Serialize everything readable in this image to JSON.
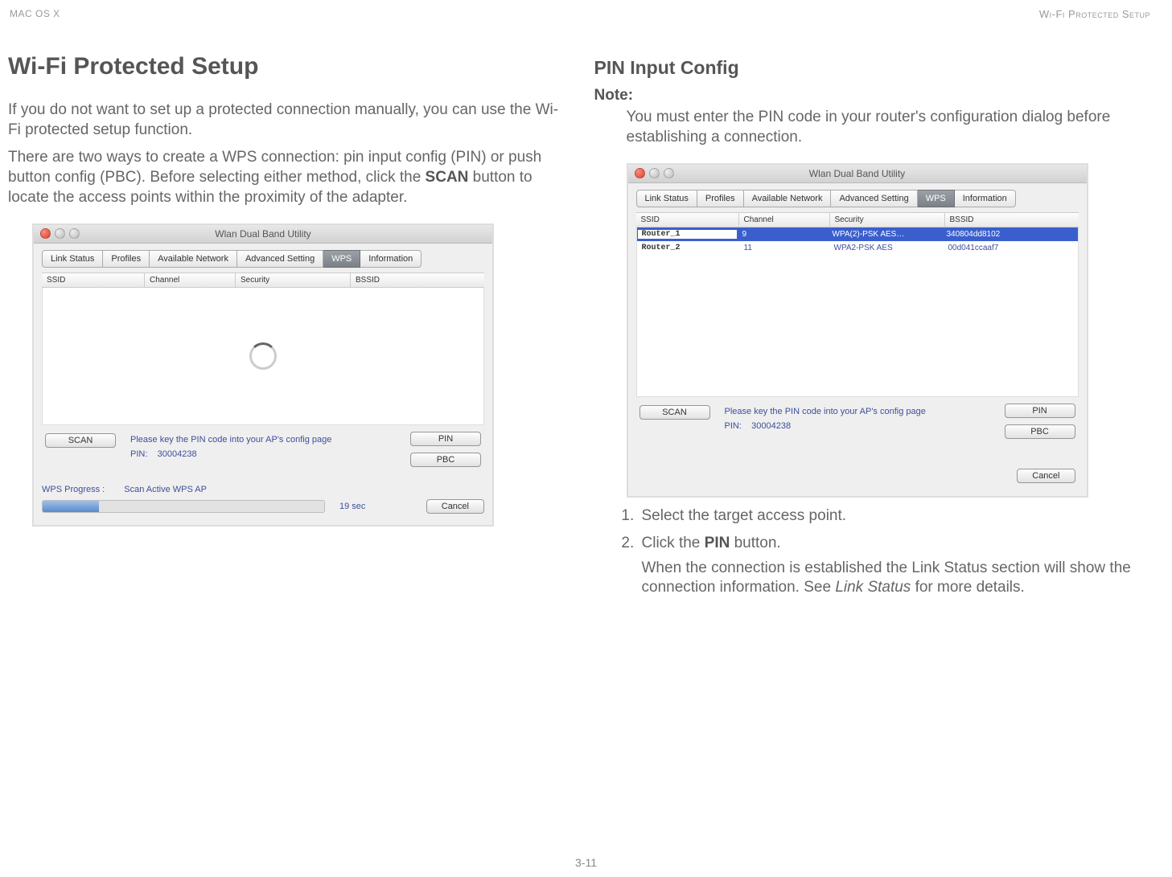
{
  "header": {
    "left": "MAC OS X",
    "right": "Wi-Fi Protected Setup"
  },
  "left_col": {
    "title": "Wi-Fi Protected Setup",
    "para1": "If you do not want to set up a protected connection manually, you can use the Wi-Fi protected setup function.",
    "para2_pre": "There are two ways to create a WPS connection: pin input config (PIN) or push button config (PBC). Before selecting either method, click the ",
    "para2_strong": "SCAN",
    "para2_post": " button to locate the access points within the proximity of the adapter."
  },
  "right_col": {
    "title": "PIN Input Config",
    "note_label": "Note:",
    "note_body": "You must enter the PIN code in your router's configuration dialog before establishing a connection.",
    "step1": "Select the target access point.",
    "step2_pre": "Click the ",
    "step2_strong": "PIN",
    "step2_post": " button.",
    "step2_after_a": "When the connection is established the Link Status section will show the connection information. See ",
    "step2_after_em": "Link Status",
    "step2_after_b": " for more details."
  },
  "window": {
    "title": "Wlan Dual Band Utility",
    "tabs": {
      "link_status": "Link Status",
      "profiles": "Profiles",
      "available": "Available Network",
      "advanced": "Advanced Setting",
      "wps": "WPS",
      "info": "Information"
    },
    "cols": {
      "ssid": "SSID",
      "channel": "Channel",
      "security": "Security",
      "bssid": "BSSID"
    },
    "rows": [
      {
        "ssid": "Router_1",
        "ch": "9",
        "sec": "WPA(2)-PSK AES…",
        "bssid": "340804dd8102"
      },
      {
        "ssid": "Router_2",
        "ch": "11",
        "sec": "WPA2-PSK AES",
        "bssid": "00d041ccaaf7"
      }
    ],
    "scan": "SCAN",
    "hint": "Please key the PIN code into your AP's config page",
    "pin_label": "PIN:",
    "pin_value": "30004238",
    "pin_btn": "PIN",
    "pbc_btn": "PBC",
    "progress_label": "WPS Progress :",
    "progress_status": "Scan Active WPS AP",
    "progress_time": "19 sec",
    "cancel": "Cancel"
  },
  "footer": {
    "page": "3-11"
  }
}
